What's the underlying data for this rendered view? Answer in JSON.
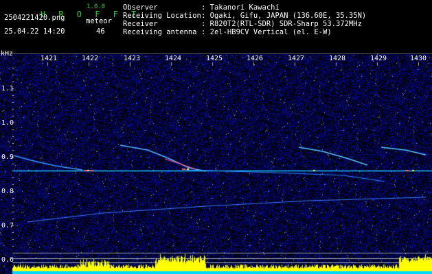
{
  "app": {
    "name": "H R O F F T",
    "version": "1.0.0"
  },
  "file": {
    "name": "2504221420.png",
    "datetime": "25.04.22 14:20"
  },
  "detection": {
    "label": "meteor",
    "count": "46"
  },
  "station": {
    "rows": [
      {
        "label": "Observer",
        "value": ": Takanori Kawachi"
      },
      {
        "label": "Receiving Location",
        "value": ": Ogaki, Gifu, JAPAN (136.60E, 35.35N)"
      },
      {
        "label": "Receiver",
        "value": ": R820T2(RTL-SDR) SDR-Sharp 53.372MHz"
      },
      {
        "label": "Receiving antenna",
        "value": ": 2el-HB9CV Vertical (el. E-W)"
      }
    ]
  },
  "axes": {
    "y_unit": "kHz",
    "x_ticks": [
      "1421",
      "1422",
      "1423",
      "1424",
      "1425",
      "1426",
      "1427",
      "1428",
      "1429",
      "1430"
    ],
    "y_ticks": [
      "1.1",
      "1.0",
      "0.9",
      "0.8",
      "0.7",
      "0.6"
    ]
  },
  "colors": {
    "logo": "#2fd02f",
    "background": "#000000",
    "noise": "#0a0aa0",
    "activity": "#ffff00",
    "baseline": "#00d8ff"
  }
}
